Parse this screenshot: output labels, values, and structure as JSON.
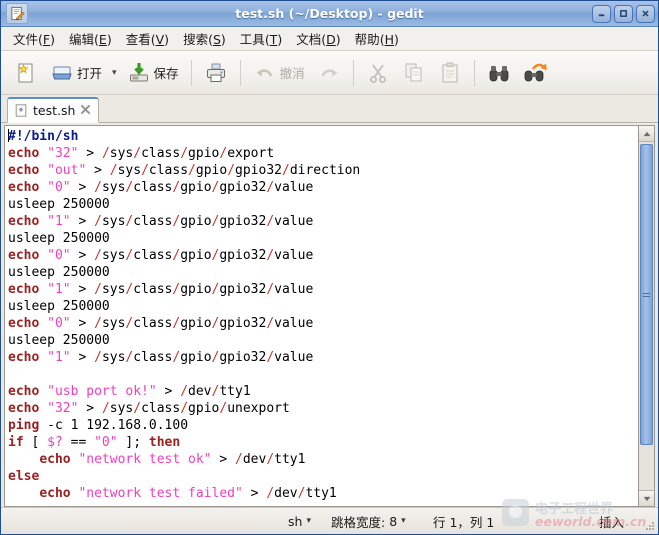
{
  "window": {
    "title": "test.sh (~/Desktop) - gedit",
    "icon": "gedit-notepad-icon",
    "buttons": {
      "minimize": "–",
      "maximize": "□",
      "close": "✕"
    }
  },
  "menubar": {
    "items": [
      {
        "label": "文件",
        "mnemonic": "F"
      },
      {
        "label": "编辑",
        "mnemonic": "E"
      },
      {
        "label": "查看",
        "mnemonic": "V"
      },
      {
        "label": "搜索",
        "mnemonic": "S"
      },
      {
        "label": "工具",
        "mnemonic": "T"
      },
      {
        "label": "文档",
        "mnemonic": "D"
      },
      {
        "label": "帮助",
        "mnemonic": "H"
      }
    ]
  },
  "toolbar": {
    "new_label": "",
    "open_label": "打开",
    "open_dropdown": "▾",
    "save_label": "保存",
    "print_label": "",
    "undo_label": "撤消",
    "redo_label": "",
    "cut_label": "",
    "copy_label": "",
    "paste_label": "",
    "find_label": "",
    "replace_label": ""
  },
  "tabs": [
    {
      "label": "test.sh",
      "close": "✖",
      "active": true
    }
  ],
  "editor": {
    "lines": [
      [
        {
          "t": "#!/bin/sh",
          "c": "k-shebang"
        }
      ],
      [
        {
          "t": "echo",
          "c": "k-cmd"
        },
        {
          "t": " "
        },
        {
          "t": "\"32\"",
          "c": "k-str"
        },
        {
          "t": " > "
        },
        {
          "t": "/",
          "c": "k-slash"
        },
        {
          "t": "sys"
        },
        {
          "t": "/",
          "c": "k-slash"
        },
        {
          "t": "class"
        },
        {
          "t": "/",
          "c": "k-slash"
        },
        {
          "t": "gpio"
        },
        {
          "t": "/",
          "c": "k-slash"
        },
        {
          "t": "export"
        }
      ],
      [
        {
          "t": "echo",
          "c": "k-cmd"
        },
        {
          "t": " "
        },
        {
          "t": "\"out\"",
          "c": "k-str"
        },
        {
          "t": " > "
        },
        {
          "t": "/",
          "c": "k-slash"
        },
        {
          "t": "sys"
        },
        {
          "t": "/",
          "c": "k-slash"
        },
        {
          "t": "class"
        },
        {
          "t": "/",
          "c": "k-slash"
        },
        {
          "t": "gpio"
        },
        {
          "t": "/",
          "c": "k-slash"
        },
        {
          "t": "gpio32"
        },
        {
          "t": "/",
          "c": "k-slash"
        },
        {
          "t": "direction"
        }
      ],
      [
        {
          "t": "echo",
          "c": "k-cmd"
        },
        {
          "t": " "
        },
        {
          "t": "\"0\"",
          "c": "k-str"
        },
        {
          "t": " > "
        },
        {
          "t": "/",
          "c": "k-slash"
        },
        {
          "t": "sys"
        },
        {
          "t": "/",
          "c": "k-slash"
        },
        {
          "t": "class"
        },
        {
          "t": "/",
          "c": "k-slash"
        },
        {
          "t": "gpio"
        },
        {
          "t": "/",
          "c": "k-slash"
        },
        {
          "t": "gpio32"
        },
        {
          "t": "/",
          "c": "k-slash"
        },
        {
          "t": "value"
        }
      ],
      [
        {
          "t": "usleep 250000"
        }
      ],
      [
        {
          "t": "echo",
          "c": "k-cmd"
        },
        {
          "t": " "
        },
        {
          "t": "\"1\"",
          "c": "k-str"
        },
        {
          "t": " > "
        },
        {
          "t": "/",
          "c": "k-slash"
        },
        {
          "t": "sys"
        },
        {
          "t": "/",
          "c": "k-slash"
        },
        {
          "t": "class"
        },
        {
          "t": "/",
          "c": "k-slash"
        },
        {
          "t": "gpio"
        },
        {
          "t": "/",
          "c": "k-slash"
        },
        {
          "t": "gpio32"
        },
        {
          "t": "/",
          "c": "k-slash"
        },
        {
          "t": "value"
        }
      ],
      [
        {
          "t": "usleep 250000"
        }
      ],
      [
        {
          "t": "echo",
          "c": "k-cmd"
        },
        {
          "t": " "
        },
        {
          "t": "\"0\"",
          "c": "k-str"
        },
        {
          "t": " > "
        },
        {
          "t": "/",
          "c": "k-slash"
        },
        {
          "t": "sys"
        },
        {
          "t": "/",
          "c": "k-slash"
        },
        {
          "t": "class"
        },
        {
          "t": "/",
          "c": "k-slash"
        },
        {
          "t": "gpio"
        },
        {
          "t": "/",
          "c": "k-slash"
        },
        {
          "t": "gpio32"
        },
        {
          "t": "/",
          "c": "k-slash"
        },
        {
          "t": "value"
        }
      ],
      [
        {
          "t": "usleep 250000"
        }
      ],
      [
        {
          "t": "echo",
          "c": "k-cmd"
        },
        {
          "t": " "
        },
        {
          "t": "\"1\"",
          "c": "k-str"
        },
        {
          "t": " > "
        },
        {
          "t": "/",
          "c": "k-slash"
        },
        {
          "t": "sys"
        },
        {
          "t": "/",
          "c": "k-slash"
        },
        {
          "t": "class"
        },
        {
          "t": "/",
          "c": "k-slash"
        },
        {
          "t": "gpio"
        },
        {
          "t": "/",
          "c": "k-slash"
        },
        {
          "t": "gpio32"
        },
        {
          "t": "/",
          "c": "k-slash"
        },
        {
          "t": "value"
        }
      ],
      [
        {
          "t": "usleep 250000"
        }
      ],
      [
        {
          "t": "echo",
          "c": "k-cmd"
        },
        {
          "t": " "
        },
        {
          "t": "\"0\"",
          "c": "k-str"
        },
        {
          "t": " > "
        },
        {
          "t": "/",
          "c": "k-slash"
        },
        {
          "t": "sys"
        },
        {
          "t": "/",
          "c": "k-slash"
        },
        {
          "t": "class"
        },
        {
          "t": "/",
          "c": "k-slash"
        },
        {
          "t": "gpio"
        },
        {
          "t": "/",
          "c": "k-slash"
        },
        {
          "t": "gpio32"
        },
        {
          "t": "/",
          "c": "k-slash"
        },
        {
          "t": "value"
        }
      ],
      [
        {
          "t": "usleep 250000"
        }
      ],
      [
        {
          "t": "echo",
          "c": "k-cmd"
        },
        {
          "t": " "
        },
        {
          "t": "\"1\"",
          "c": "k-str"
        },
        {
          "t": " > "
        },
        {
          "t": "/",
          "c": "k-slash"
        },
        {
          "t": "sys"
        },
        {
          "t": "/",
          "c": "k-slash"
        },
        {
          "t": "class"
        },
        {
          "t": "/",
          "c": "k-slash"
        },
        {
          "t": "gpio"
        },
        {
          "t": "/",
          "c": "k-slash"
        },
        {
          "t": "gpio32"
        },
        {
          "t": "/",
          "c": "k-slash"
        },
        {
          "t": "value"
        }
      ],
      [
        {
          "t": ""
        }
      ],
      [
        {
          "t": "echo",
          "c": "k-cmd"
        },
        {
          "t": " "
        },
        {
          "t": "\"usb port ok!\"",
          "c": "k-str"
        },
        {
          "t": " > "
        },
        {
          "t": "/",
          "c": "k-slash"
        },
        {
          "t": "dev"
        },
        {
          "t": "/",
          "c": "k-slash"
        },
        {
          "t": "tty1"
        }
      ],
      [
        {
          "t": "echo",
          "c": "k-cmd"
        },
        {
          "t": " "
        },
        {
          "t": "\"32\"",
          "c": "k-str"
        },
        {
          "t": " > "
        },
        {
          "t": "/",
          "c": "k-slash"
        },
        {
          "t": "sys"
        },
        {
          "t": "/",
          "c": "k-slash"
        },
        {
          "t": "class"
        },
        {
          "t": "/",
          "c": "k-slash"
        },
        {
          "t": "gpio"
        },
        {
          "t": "/",
          "c": "k-slash"
        },
        {
          "t": "unexport"
        }
      ],
      [
        {
          "t": "ping",
          "c": "k-cmd"
        },
        {
          "t": " -c 1 192.168.0.100"
        }
      ],
      [
        {
          "t": "if",
          "c": "k-kw"
        },
        {
          "t": " [ "
        },
        {
          "t": "$?",
          "c": "k-var"
        },
        {
          "t": " == "
        },
        {
          "t": "\"0\"",
          "c": "k-str"
        },
        {
          "t": " ]; "
        },
        {
          "t": "then",
          "c": "k-kw"
        }
      ],
      [
        {
          "t": "    "
        },
        {
          "t": "echo",
          "c": "k-cmd"
        },
        {
          "t": " "
        },
        {
          "t": "\"network test ok\"",
          "c": "k-str"
        },
        {
          "t": " > "
        },
        {
          "t": "/",
          "c": "k-slash"
        },
        {
          "t": "dev"
        },
        {
          "t": "/",
          "c": "k-slash"
        },
        {
          "t": "tty1"
        }
      ],
      [
        {
          "t": "else",
          "c": "k-kw"
        }
      ],
      [
        {
          "t": "    "
        },
        {
          "t": "echo",
          "c": "k-cmd"
        },
        {
          "t": " "
        },
        {
          "t": "\"network test failed\"",
          "c": "k-str"
        },
        {
          "t": " > "
        },
        {
          "t": "/",
          "c": "k-slash"
        },
        {
          "t": "dev"
        },
        {
          "t": "/",
          "c": "k-slash"
        },
        {
          "t": "tty1"
        }
      ]
    ]
  },
  "scrollbar": {
    "up_arrow": "▲",
    "down_arrow": "▼"
  },
  "statusbar": {
    "language": "sh",
    "language_caret": "▾",
    "tab_width_label": "跳格宽度:",
    "tab_width_value": "8",
    "tab_width_caret": "▾",
    "position": "行 1，列 1",
    "insert_mode": "插入"
  },
  "watermark": {
    "cn": "电子工程世界",
    "en": "eeworld.com.cn"
  },
  "colors": {
    "titlebar": "#8fb0dc",
    "accent": "#5b8dd0",
    "keyword": "#9c2020",
    "string": "#ef3fbf",
    "shebang": "#0b1a8c",
    "path_slash": "#c0392b",
    "chrome": "#ece9e3"
  }
}
